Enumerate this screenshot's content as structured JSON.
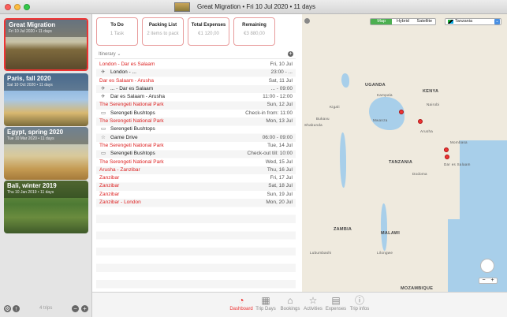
{
  "window": {
    "title": "Great Migration • Fri 10 Jul 2020 • 11 days"
  },
  "sidebar": {
    "trips": [
      {
        "name": "Great Migration",
        "dates": "Fri 10 Jul 2020 • 11 days",
        "selected": true
      },
      {
        "name": "Paris, fall 2020",
        "dates": "Sat 10 Oct 2020 • 11 days",
        "selected": false
      },
      {
        "name": "Egypt, spring 2020",
        "dates": "Tue 10 Mar 2020 • 11 days",
        "selected": false
      },
      {
        "name": "Bali, winter 2019",
        "dates": "Thu 10 Jan 2019 • 11 days",
        "selected": false
      }
    ],
    "trips_count": "4 trips"
  },
  "summary": {
    "cards": [
      {
        "title": "To Do",
        "value": "1 Task"
      },
      {
        "title": "Packing List",
        "value": "2 items to pack"
      },
      {
        "title": "Total Expenses",
        "value": "€1 120,00"
      },
      {
        "title": "Remaining",
        "value": "€3 880,00"
      }
    ]
  },
  "itinerary": {
    "label": "Itinerary",
    "rows": [
      {
        "kind": "day",
        "left": "London - Dar es Salaam",
        "right": "Fri, 10 Jul"
      },
      {
        "kind": "sub",
        "icon": "plane-icon",
        "left": "London - ...",
        "right": "23:00 - ..."
      },
      {
        "kind": "day",
        "left": "Dar es Salaam - Arusha",
        "right": "Sat, 11 Jul"
      },
      {
        "kind": "sub",
        "icon": "plane-icon",
        "left": "... - Dar es Salaam",
        "right": "... - 09:00"
      },
      {
        "kind": "sub",
        "icon": "plane-icon",
        "left": "Dar es Salaam - Arusha",
        "right": "11:00 - 12:00"
      },
      {
        "kind": "day",
        "left": "The Serengeti National Park",
        "right": "Sun, 12 Jul"
      },
      {
        "kind": "sub",
        "icon": "bed-icon",
        "left": "Serengeti Bushtops",
        "right": "Check-in from: 11:00"
      },
      {
        "kind": "day",
        "left": "The Serengeti National Park",
        "right": "Mon, 13 Jul"
      },
      {
        "kind": "sub",
        "icon": "bed-icon",
        "left": "Serengeti Bushtops",
        "right": ""
      },
      {
        "kind": "sub",
        "icon": "star-icon",
        "left": "Game Drive",
        "right": "06:00 - 09:00"
      },
      {
        "kind": "day",
        "left": "The Serengeti National Park",
        "right": "Tue, 14 Jul"
      },
      {
        "kind": "sub",
        "icon": "bed-icon",
        "left": "Serengeti Bushtops",
        "right": "Check-out till: 10:00"
      },
      {
        "kind": "day",
        "left": "The Serengeti National Park",
        "right": "Wed, 15 Jul"
      },
      {
        "kind": "day",
        "left": "Arusha - Zanzibar",
        "right": "Thu, 16 Jul"
      },
      {
        "kind": "day",
        "left": "Zanzibar",
        "right": "Fri, 17 Jul"
      },
      {
        "kind": "day",
        "left": "Zanzibar",
        "right": "Sat, 18 Jul"
      },
      {
        "kind": "day",
        "left": "Zanzibar",
        "right": "Sun, 19 Jul"
      },
      {
        "kind": "day",
        "left": "Zanzibar - London",
        "right": "Mon, 20 Jul"
      }
    ]
  },
  "map": {
    "types": [
      "Map",
      "Hybrid",
      "Satellite"
    ],
    "active_type": "Map",
    "country": "Tanzania",
    "labels": {
      "uganda": "UGANDA",
      "kenya": "KENYA",
      "tanzania": "TANZANIA",
      "malawi": "MALAWI",
      "zambia": "ZAMBIA",
      "mozambique": "MOZAMBIQUE",
      "nairobi": "Nairobi",
      "mombasa": "Mombasa",
      "dar": "Dar es Salaam",
      "kigali": "Kigali",
      "arusha": "Arusha",
      "mwanza": "Mwanza",
      "dodoma": "Dodoma",
      "lilongwe": "Lilongwe",
      "bukavu": "Bukavu",
      "shabunda": "Shabunda",
      "lubumbashi": "Lubumbashi",
      "kampala": "Kampala"
    }
  },
  "tabs": [
    {
      "label": "Dashboard",
      "icon": "dashboard-icon",
      "glyph": "◔",
      "active": true
    },
    {
      "label": "Trip Days",
      "icon": "calendar-icon",
      "glyph": "▦",
      "active": false
    },
    {
      "label": "Bookings",
      "icon": "bookings-icon",
      "glyph": "⌂",
      "active": false
    },
    {
      "label": "Activities",
      "icon": "activities-icon",
      "glyph": "☆",
      "active": false
    },
    {
      "label": "Expenses",
      "icon": "expenses-icon",
      "glyph": "▤",
      "active": false
    },
    {
      "label": "Trip infos",
      "icon": "info-icon",
      "glyph": "ⓘ",
      "active": false
    }
  ],
  "colors": {
    "accent": "#e33333",
    "map_button_active": "#4caf50"
  }
}
